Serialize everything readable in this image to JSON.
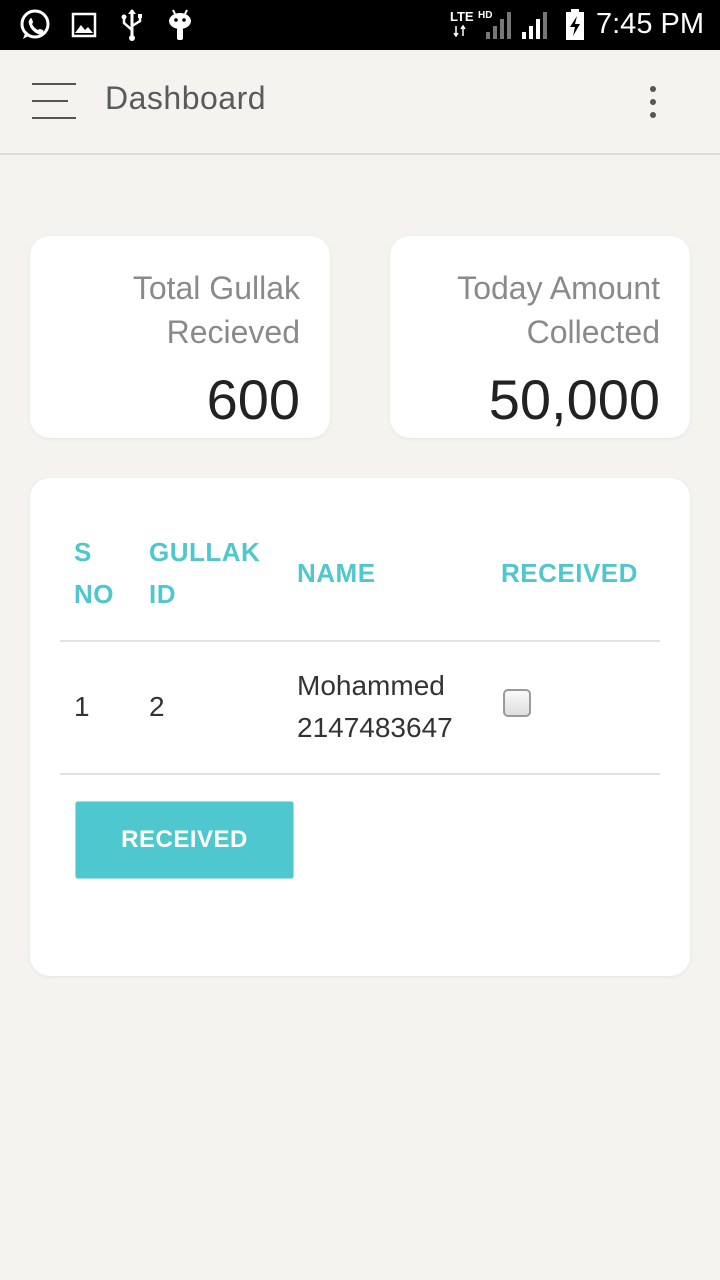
{
  "status_bar": {
    "time": "7:45 PM",
    "network_label": "LTE",
    "hd_label": "HD",
    "icons": [
      "whatsapp-icon",
      "image-icon",
      "usb-icon",
      "android-icon",
      "signal-icon",
      "signal-icon",
      "battery-charging-icon"
    ]
  },
  "app_bar": {
    "title": "Dashboard",
    "menu_icon": "hamburger-menu-icon",
    "more_icon": "more-vert-icon"
  },
  "stats": {
    "total_gullak": {
      "label_line1": "Total Gullak",
      "label_line2": "Recieved",
      "value": "600"
    },
    "today_amount": {
      "label_line1": "Today Amount",
      "label_line2": "Collected",
      "value": "50,000"
    }
  },
  "table": {
    "headers": {
      "sno_line1": "S",
      "sno_line2": "NO",
      "gullak_line1": "GULLAK",
      "gullak_line2": "ID",
      "name": "NAME",
      "received": "RECEIVED"
    },
    "rows": [
      {
        "sno": "1",
        "gullak_id": "2",
        "name": "Mohammed",
        "phone": "2147483647",
        "received": false
      }
    ]
  },
  "actions": {
    "received_button": "RECEIVED"
  },
  "colors": {
    "accent": "#4ec7cf",
    "background": "#f4f3f0",
    "card": "#ffffff"
  }
}
